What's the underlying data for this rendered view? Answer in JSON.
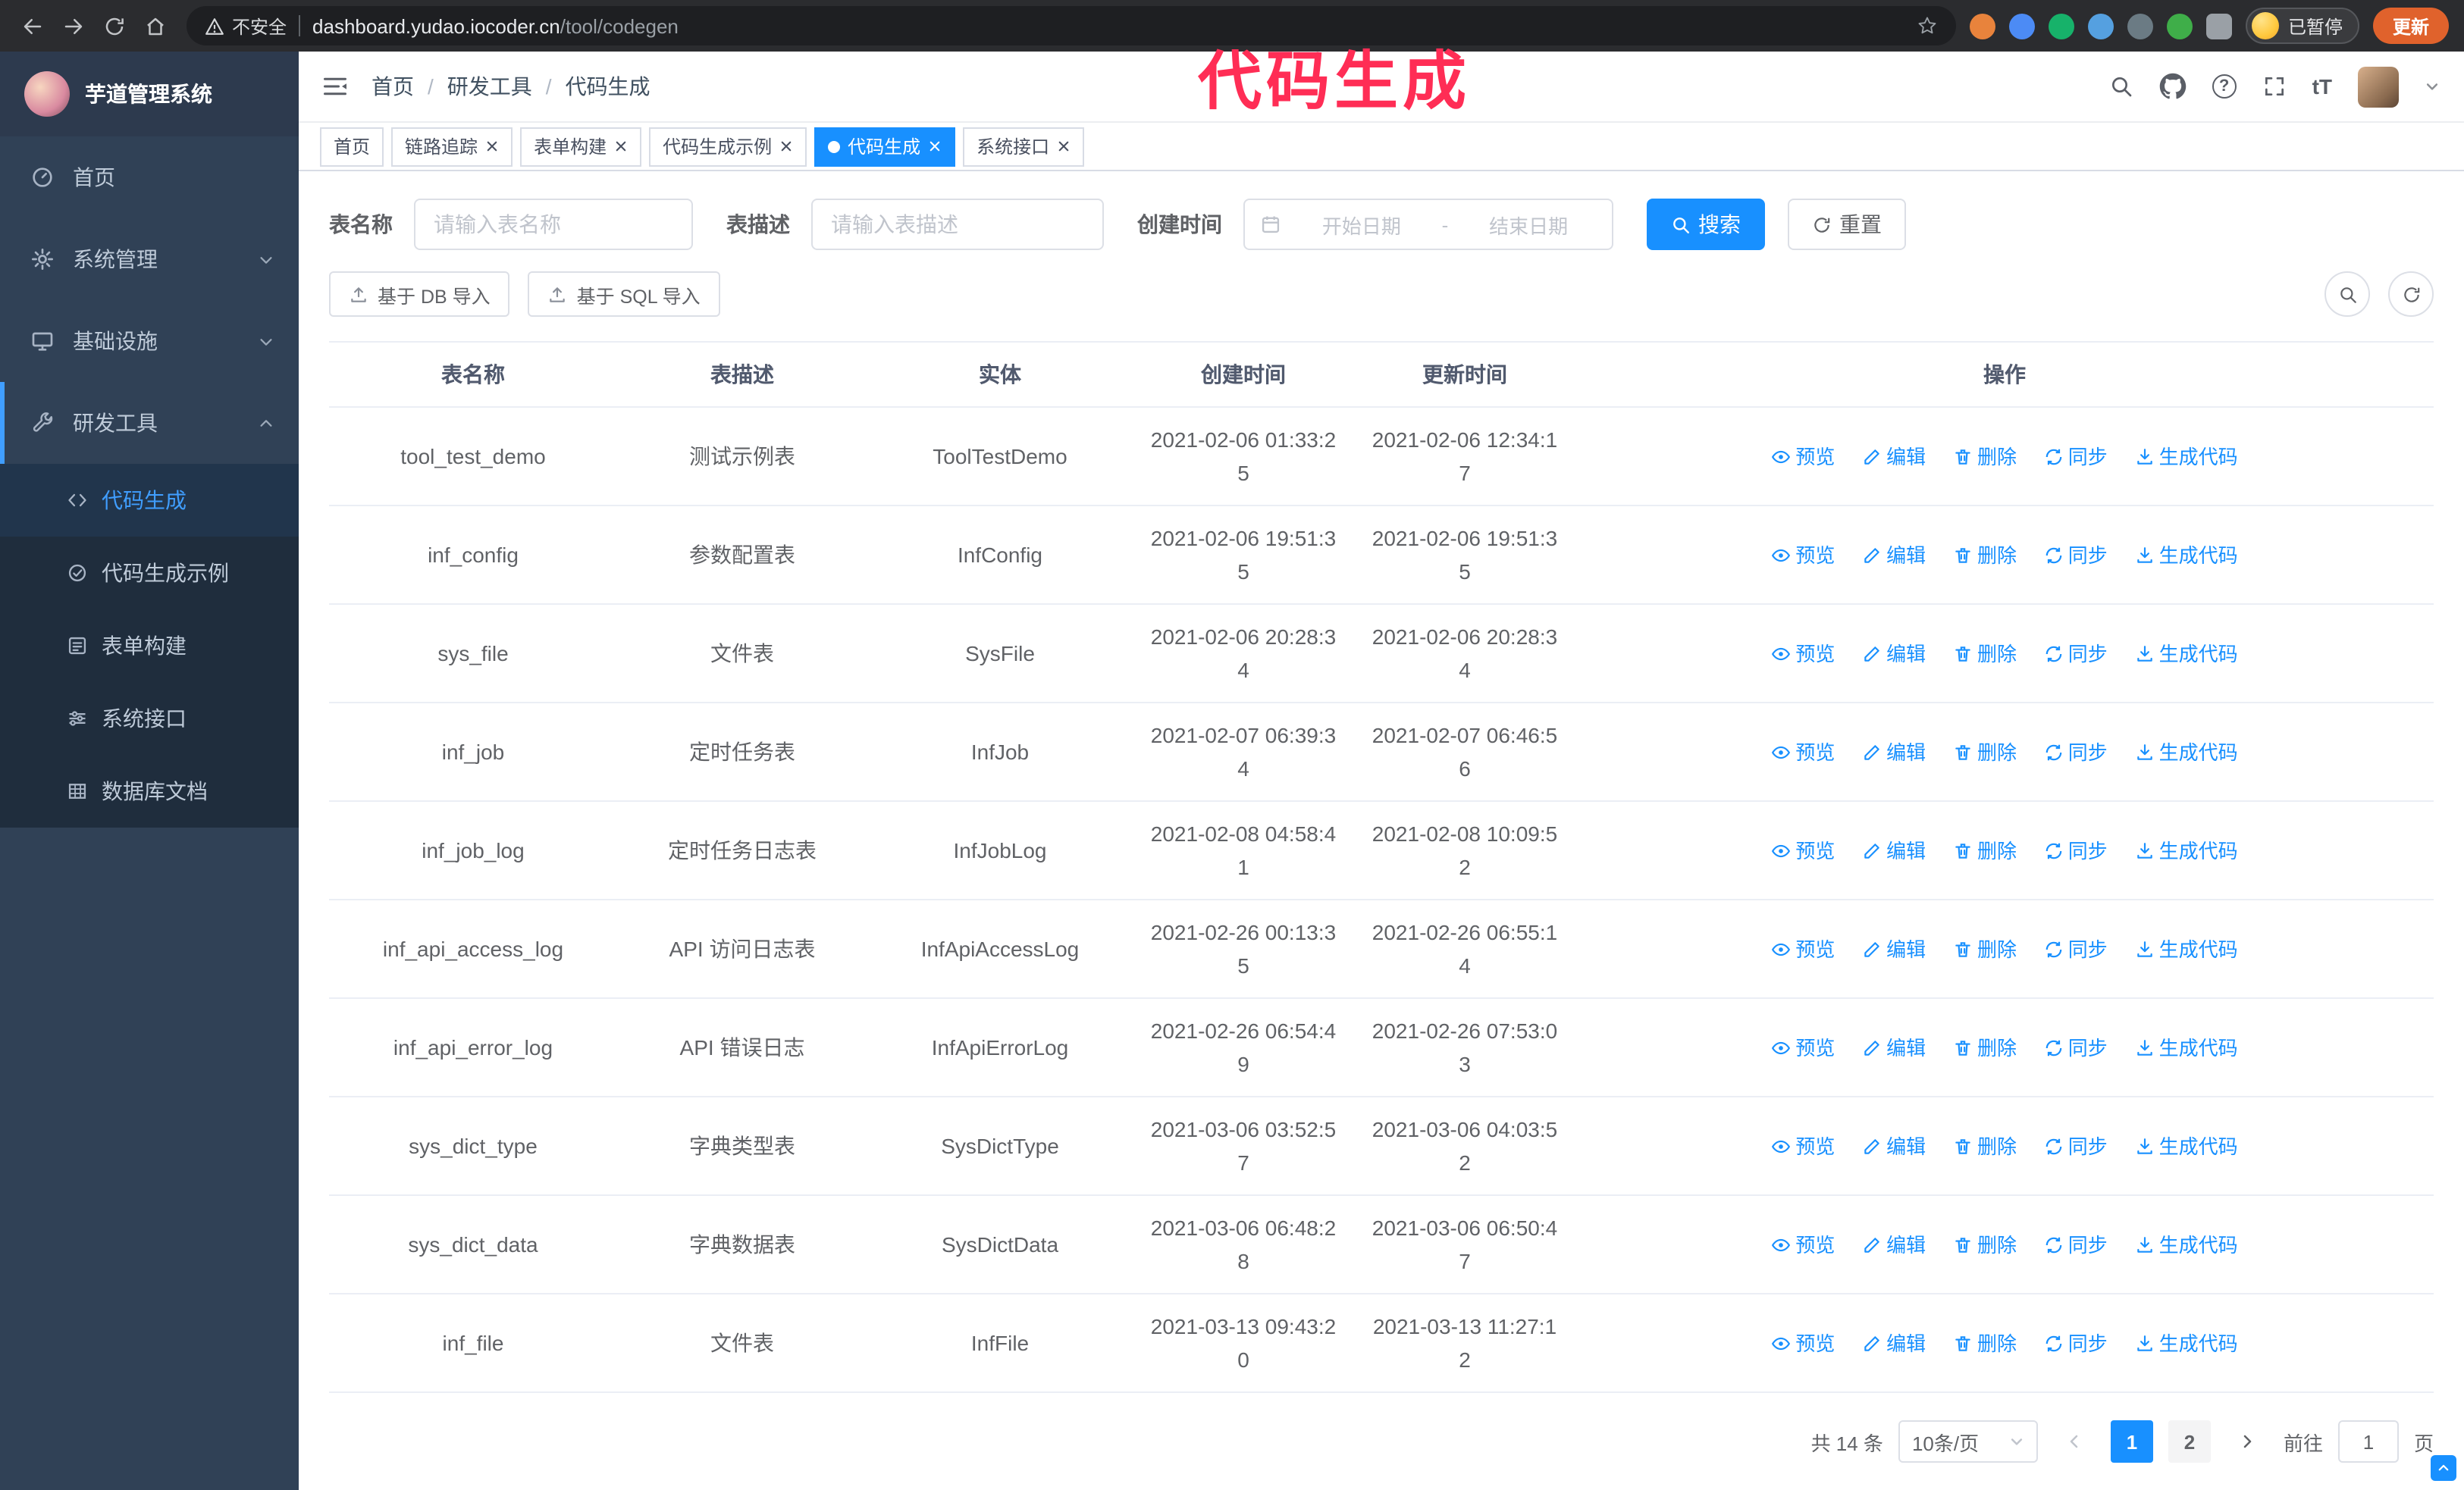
{
  "annotation": {
    "text": "代码生成",
    "color": "#ff2d55"
  },
  "browser": {
    "security_label": "不安全",
    "url_host": "dashboard.yudao.iocoder.cn",
    "url_path": "/tool/codegen",
    "paused_badge_label": "已暂停",
    "update_button_label": "更新"
  },
  "sidebar": {
    "logo_title": "芋道管理系统",
    "items": [
      {
        "label": "首页"
      },
      {
        "label": "系统管理"
      },
      {
        "label": "基础设施"
      },
      {
        "label": "研发工具"
      }
    ],
    "submenu": [
      {
        "label": "代码生成"
      },
      {
        "label": "代码生成示例"
      },
      {
        "label": "表单构建"
      },
      {
        "label": "系统接口"
      },
      {
        "label": "数据库文档"
      }
    ]
  },
  "navbar": {
    "breadcrumb": [
      "首页",
      "研发工具",
      "代码生成"
    ],
    "separator": "/"
  },
  "tabs": [
    {
      "label": "首页",
      "closable": false,
      "active": false
    },
    {
      "label": "链路追踪",
      "closable": true,
      "active": false
    },
    {
      "label": "表单构建",
      "closable": true,
      "active": false
    },
    {
      "label": "代码生成示例",
      "closable": true,
      "active": false
    },
    {
      "label": "代码生成",
      "closable": true,
      "active": true
    },
    {
      "label": "系统接口",
      "closable": true,
      "active": false
    }
  ],
  "filters": {
    "table_name_label": "表名称",
    "table_name_placeholder": "请输入表名称",
    "table_desc_label": "表描述",
    "table_desc_placeholder": "请输入表描述",
    "create_time_label": "创建时间",
    "date_start_placeholder": "开始日期",
    "date_separator": "-",
    "date_end_placeholder": "结束日期",
    "search_button_label": "搜索",
    "reset_button_label": "重置"
  },
  "toolbar": {
    "import_db_label": "基于 DB 导入",
    "import_sql_label": "基于 SQL 导入"
  },
  "table": {
    "columns": [
      "表名称",
      "表描述",
      "实体",
      "创建时间",
      "更新时间",
      "操作"
    ],
    "actions": {
      "preview": "预览",
      "edit": "编辑",
      "delete": "删除",
      "sync": "同步",
      "generate": "生成代码"
    },
    "rows": [
      {
        "name": "tool_test_demo",
        "desc": "测试示例表",
        "entity": "ToolTestDemo",
        "created": "2021-02-06 01:33:25",
        "updated": "2021-02-06 12:34:17"
      },
      {
        "name": "inf_config",
        "desc": "参数配置表",
        "entity": "InfConfig",
        "created": "2021-02-06 19:51:35",
        "updated": "2021-02-06 19:51:35"
      },
      {
        "name": "sys_file",
        "desc": "文件表",
        "entity": "SysFile",
        "created": "2021-02-06 20:28:34",
        "updated": "2021-02-06 20:28:34"
      },
      {
        "name": "inf_job",
        "desc": "定时任务表",
        "entity": "InfJob",
        "created": "2021-02-07 06:39:34",
        "updated": "2021-02-07 06:46:56"
      },
      {
        "name": "inf_job_log",
        "desc": "定时任务日志表",
        "entity": "InfJobLog",
        "created": "2021-02-08 04:58:41",
        "updated": "2021-02-08 10:09:52"
      },
      {
        "name": "inf_api_access_log",
        "desc": "API 访问日志表",
        "entity": "InfApiAccessLog",
        "created": "2021-02-26 00:13:35",
        "updated": "2021-02-26 06:55:14"
      },
      {
        "name": "inf_api_error_log",
        "desc": "API 错误日志",
        "entity": "InfApiErrorLog",
        "created": "2021-02-26 06:54:49",
        "updated": "2021-02-26 07:53:03"
      },
      {
        "name": "sys_dict_type",
        "desc": "字典类型表",
        "entity": "SysDictType",
        "created": "2021-03-06 03:52:57",
        "updated": "2021-03-06 04:03:52"
      },
      {
        "name": "sys_dict_data",
        "desc": "字典数据表",
        "entity": "SysDictData",
        "created": "2021-03-06 06:48:28",
        "updated": "2021-03-06 06:50:47"
      },
      {
        "name": "inf_file",
        "desc": "文件表",
        "entity": "InfFile",
        "created": "2021-03-13 09:43:20",
        "updated": "2021-03-13 11:27:12"
      }
    ]
  },
  "pagination": {
    "total_label": "共 14 条",
    "page_size_label": "10条/页",
    "pages": [
      "1",
      "2"
    ],
    "goto_label": "前往",
    "goto_value": "1",
    "goto_unit": "页"
  },
  "colors": {
    "primary": "#1890ff",
    "sidebar": "#304156",
    "submenu": "#1f2d3d",
    "active_menu_text": "#409eff",
    "annotation": "#ff2d55",
    "update_button": "#e0622c"
  }
}
